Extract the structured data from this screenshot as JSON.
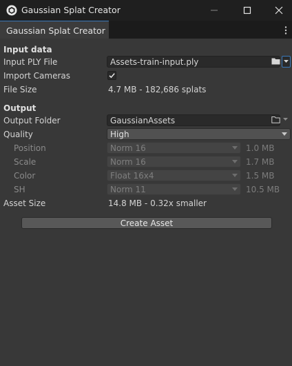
{
  "window": {
    "title": "Gaussian Splat Creator",
    "minimize_icon": "minimize-icon",
    "maximize_icon": "maximize-icon",
    "close_icon": "close-icon",
    "app_icon": "unity-logo-icon"
  },
  "tab": {
    "label": "Gaussian Splat Creator",
    "menu_icon": "more-vertical-icon"
  },
  "input_section": {
    "header": "Input data",
    "ply_label": "Input PLY File",
    "ply_value": "Assets-train-input.ply",
    "import_cameras_label": "Import Cameras",
    "import_cameras_checked": true,
    "file_size_label": "File Size",
    "file_size_value": "4.7 MB - 182,686 splats"
  },
  "output_section": {
    "header": "Output",
    "folder_label": "Output Folder",
    "folder_value": "GaussianAssets",
    "quality_label": "Quality",
    "quality_value": "High",
    "position_label": "Position",
    "position_value": "Norm 16",
    "position_size": "1.0 MB",
    "scale_label": "Scale",
    "scale_value": "Norm 16",
    "scale_size": "1.7 MB",
    "color_label": "Color",
    "color_value": "Float 16x4",
    "color_size": "1.5 MB",
    "sh_label": "SH",
    "sh_value": "Norm 11",
    "sh_size": "10.5 MB",
    "asset_size_label": "Asset Size",
    "asset_size_value": "14.8 MB - 0.32x smaller"
  },
  "actions": {
    "create_label": "Create Asset"
  },
  "colors": {
    "background": "#383838",
    "titlebar": "#1f1f1f",
    "tab_accent": "#3a79bb",
    "field": "#2a2a2a",
    "dropdown": "#515151"
  }
}
